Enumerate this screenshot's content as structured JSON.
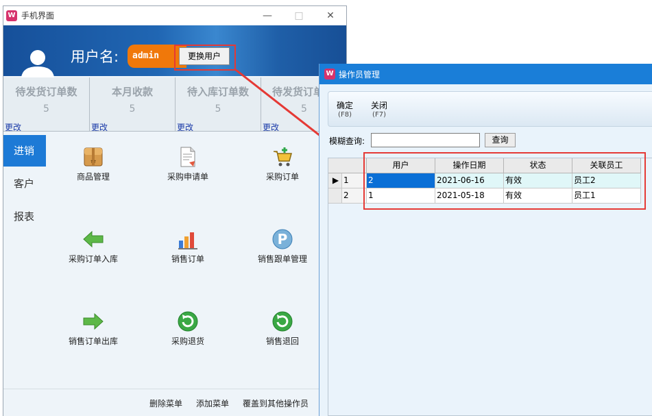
{
  "main_window": {
    "title": "手机界面",
    "header": {
      "username_label": "用户名:",
      "username_value": "admin",
      "switch_user_button": "更换用户"
    },
    "stats": [
      {
        "title": "待发货订单数",
        "value": "5",
        "link": "更改"
      },
      {
        "title": "本月收款",
        "value": "5",
        "link": "更改"
      },
      {
        "title": "待入库订单数",
        "value": "5",
        "link": "更改"
      },
      {
        "title": "待发货订单",
        "value": "5",
        "link": "更改"
      }
    ],
    "nav": [
      {
        "label": "进销",
        "active": true
      },
      {
        "label": "客户"
      },
      {
        "label": "报表"
      }
    ],
    "tiles": [
      {
        "label": "商品管理",
        "icon": "goods-box-icon"
      },
      {
        "label": "采购申请单",
        "icon": "document-icon"
      },
      {
        "label": "采购订单",
        "icon": "shopping-cart-icon"
      },
      {
        "label": "采购订单入库",
        "icon": "arrow-left-icon"
      },
      {
        "label": "销售订单",
        "icon": "bar-chart-icon"
      },
      {
        "label": "销售跟单管理",
        "icon": "p-circle-icon"
      },
      {
        "label": "销售订单出库",
        "icon": "arrow-right-icon"
      },
      {
        "label": "采购退货",
        "icon": "refresh-icon"
      },
      {
        "label": "销售退回",
        "icon": "refresh-icon"
      }
    ],
    "bottom_links": [
      "删除菜单",
      "添加菜单",
      "覆盖到其他操作员"
    ]
  },
  "dialog": {
    "title": "操作员管理",
    "toolbar": [
      {
        "label": "确定",
        "key": "(F8)"
      },
      {
        "label": "关闭",
        "key": "(F7)"
      }
    ],
    "search": {
      "label": "模糊查询:",
      "value": "",
      "button": "查询"
    },
    "grid": {
      "columns": [
        "用户",
        "操作日期",
        "状态",
        "关联员工"
      ],
      "rows": [
        {
          "num": "1",
          "cells": [
            "2",
            "2021-06-16",
            "有效",
            "员工2"
          ],
          "selected": true
        },
        {
          "num": "2",
          "cells": [
            "1",
            "2021-05-18",
            "有效",
            "员工1"
          ]
        }
      ]
    }
  },
  "colors": {
    "header_blue": "#2066b3",
    "accent_orange": "#f0780a",
    "highlight_red": "#e53935",
    "selection_blue": "#0a6fd6"
  }
}
